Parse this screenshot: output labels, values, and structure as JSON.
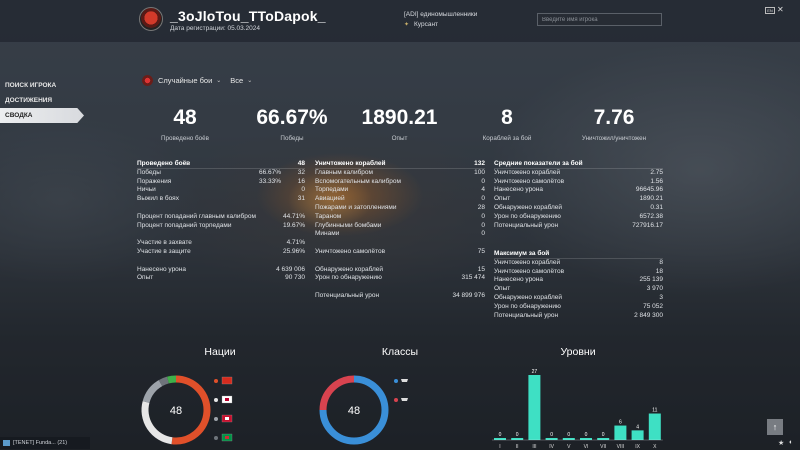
{
  "header": {
    "player_name": "_3oJloTou_TToDapok_",
    "reg_date": "Дата регистрации: 05.03.2024",
    "clan": "[ADI] единомышленники",
    "role": "Курсант",
    "search_placeholder": "Введите имя игрока",
    "badge": "EN"
  },
  "nav": {
    "items": [
      {
        "label": "Поиск игрока"
      },
      {
        "label": "Достижения"
      },
      {
        "label": "Сводка"
      }
    ]
  },
  "filter": {
    "mode": "Случайные бои",
    "scope": "Все"
  },
  "summary": [
    {
      "value": "48",
      "label": "Проведено боёв"
    },
    {
      "value": "66.67%",
      "label": "Победы"
    },
    {
      "value": "1890.21",
      "label": "Опыт"
    },
    {
      "value": "8",
      "label": "Кораблей за бой"
    },
    {
      "value": "7.76",
      "label": "Уничтожил/уничтожен"
    }
  ],
  "battles": {
    "head": {
      "label": "Проведено боёв",
      "val": "48"
    },
    "rows": [
      {
        "label": "Победы",
        "pct": "66.67%",
        "val": "32"
      },
      {
        "label": "Поражения",
        "pct": "33.33%",
        "val": "16"
      },
      {
        "label": "Ничьи",
        "pct": "",
        "val": "0"
      },
      {
        "label": "Выжил в боях",
        "pct": "",
        "val": "31"
      },
      {
        "gap": true
      },
      {
        "label": "Процент попаданий главным калибром",
        "pct": "",
        "val": "44.71%"
      },
      {
        "label": "Процент попаданий торпедами",
        "pct": "",
        "val": "19.67%"
      },
      {
        "gap": true
      },
      {
        "label": "Участие в захвате",
        "pct": "",
        "val": "4.71%"
      },
      {
        "label": "Участие в защите",
        "pct": "",
        "val": "25.96%"
      },
      {
        "gap": true
      },
      {
        "label": "Нанесено урона",
        "pct": "",
        "val": "4 639 006"
      },
      {
        "label": "Опыт",
        "pct": "",
        "val": "90 730"
      }
    ]
  },
  "destroyed": {
    "head": {
      "label": "Уничтожено кораблей",
      "val": "132"
    },
    "rows": [
      {
        "label": "Главным калибром",
        "val": "100"
      },
      {
        "label": "Вспомогательным калибром",
        "val": "0"
      },
      {
        "label": "Торпедами",
        "val": "4"
      },
      {
        "label": "Авиацией",
        "val": "0"
      },
      {
        "label": "Пожарами и затоплениями",
        "val": "28"
      },
      {
        "label": "Тараном",
        "val": "0"
      },
      {
        "label": "Глубинными бомбами",
        "val": "0"
      },
      {
        "label": "Минами",
        "val": "0"
      },
      {
        "gap": true
      },
      {
        "label": "Уничтожено самолётов",
        "val": "75"
      },
      {
        "gap": true
      },
      {
        "label": "Обнаружено кораблей",
        "val": "15"
      },
      {
        "label": "Урон по обнаружению",
        "val": "315 474"
      },
      {
        "gap": true
      },
      {
        "label": "Потенциальный урон",
        "val": "34 899 976"
      }
    ]
  },
  "averages": {
    "head": {
      "label": "Средние показатели за бой"
    },
    "rows": [
      {
        "label": "Уничтожено кораблей",
        "val": "2.75"
      },
      {
        "label": "Уничтожено самолётов",
        "val": "1.56"
      },
      {
        "label": "Нанесено урона",
        "val": "96645.96"
      },
      {
        "label": "Опыт",
        "val": "1890.21"
      },
      {
        "label": "Обнаружено кораблей",
        "val": "0.31"
      },
      {
        "label": "Урон по обнаружению",
        "val": "6572.38"
      },
      {
        "label": "Потенциальный урон",
        "val": "727916.17"
      }
    ]
  },
  "maximums": {
    "head": {
      "label": "Максимум за бой"
    },
    "rows": [
      {
        "label": "Уничтожено кораблей",
        "val": "8"
      },
      {
        "label": "Уничтожено самолётов",
        "val": "18"
      },
      {
        "label": "Нанесено урона",
        "val": "255 139"
      },
      {
        "label": "Опыт",
        "val": "3 970"
      },
      {
        "label": "Обнаружено кораблей",
        "val": "3"
      },
      {
        "label": "Урон по обнаружению",
        "val": "75 052"
      },
      {
        "label": "Потенциальный урон",
        "val": "2 849 300"
      }
    ]
  },
  "sections": {
    "nations": "Нации",
    "classes": "Классы",
    "tiers": "Уровни"
  },
  "chart_data": [
    {
      "type": "pie",
      "title": "Нации",
      "center_label": "48",
      "slices": [
        {
          "name": "nation-1",
          "color": "#e0502a",
          "value": 25
        },
        {
          "name": "nation-2",
          "color": "#e6e6e6",
          "value": 13
        },
        {
          "name": "nation-3",
          "color": "#9da3aa",
          "value": 6
        },
        {
          "name": "nation-4",
          "color": "#6e747b",
          "value": 2
        },
        {
          "name": "nation-5",
          "color": "#3fb04a",
          "value": 2
        }
      ]
    },
    {
      "type": "pie",
      "title": "Классы",
      "center_label": "48",
      "slices": [
        {
          "name": "class-1",
          "color": "#3a8fd8",
          "value": 36
        },
        {
          "name": "class-2",
          "color": "#d8434f",
          "value": 12
        }
      ]
    },
    {
      "type": "bar",
      "title": "Уровни",
      "color": "#3ee0c4",
      "categories": [
        "I",
        "II",
        "III",
        "IV",
        "V",
        "VI",
        "VII",
        "VIII",
        "IX",
        "X"
      ],
      "values": [
        0,
        0,
        27,
        0,
        0,
        0,
        0,
        6,
        4,
        11
      ],
      "ylim": [
        0,
        27
      ]
    }
  ],
  "footer": {
    "chat": "[TENET] Funda... (21)"
  }
}
